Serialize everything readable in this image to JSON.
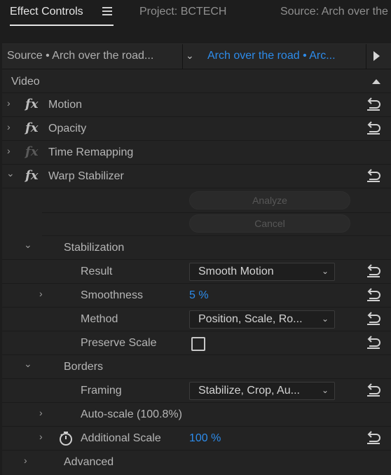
{
  "tabs": [
    {
      "label": "Effect Controls",
      "active": true
    },
    {
      "label": "Project: BCTECH",
      "active": false
    },
    {
      "label": "Source: Arch over the",
      "active": false
    }
  ],
  "source_bar": {
    "left_label": "Source • Arch over the road...",
    "right_label": "Arch over the road • Arc..."
  },
  "section_title": "Video",
  "effects": {
    "motion": "Motion",
    "opacity": "Opacity",
    "time_remapping": "Time Remapping",
    "warp_stabilizer": "Warp Stabilizer"
  },
  "warp": {
    "analyze_label": "Analyze",
    "cancel_label": "Cancel",
    "stabilization_label": "Stabilization",
    "result_label": "Result",
    "result_value": "Smooth Motion",
    "smoothness_label": "Smoothness",
    "smoothness_value": "5 %",
    "method_label": "Method",
    "method_value": "Position, Scale, Ro...",
    "preserve_scale_label": "Preserve Scale",
    "preserve_scale_checked": false,
    "borders_label": "Borders",
    "framing_label": "Framing",
    "framing_value": "Stabilize, Crop, Au...",
    "autoscale_label": "Auto-scale (100.8%)",
    "additional_scale_label": "Additional Scale",
    "additional_scale_value": "100 %",
    "advanced_label": "Advanced"
  },
  "colors": {
    "accent_blue": "#2d8ceb",
    "background": "#232323",
    "text": "#b5b5b5"
  },
  "icons": [
    "menu-icon",
    "chevron-down-icon",
    "play-icon",
    "scroll-up-icon",
    "chevron-right-icon",
    "fx-icon",
    "reset-icon",
    "stopwatch-icon"
  ]
}
